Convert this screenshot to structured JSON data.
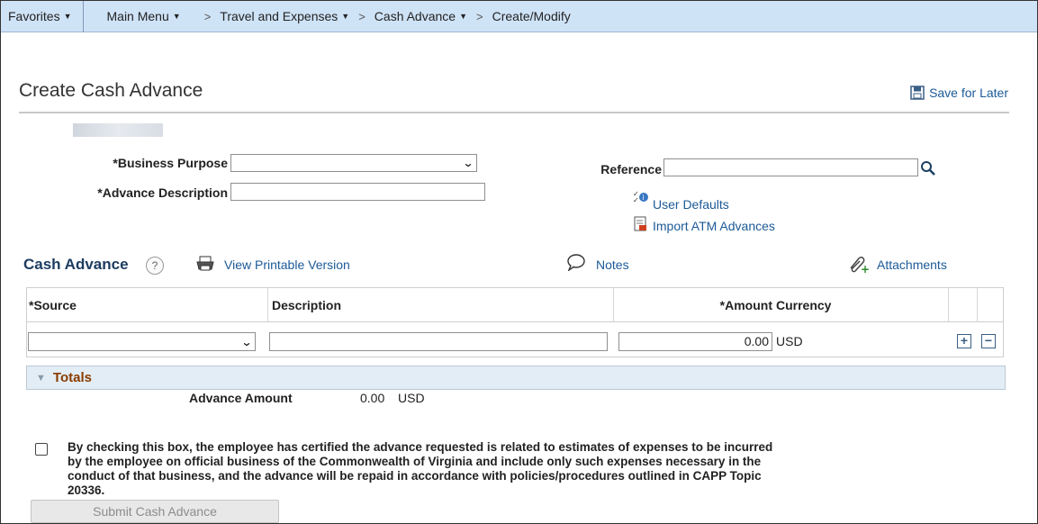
{
  "nav": {
    "favorites": "Favorites",
    "main_menu": "Main Menu",
    "breadcrumbs": [
      "Travel and Expenses",
      "Cash Advance",
      "Create/Modify"
    ]
  },
  "page": {
    "title": "Create Cash Advance",
    "save_for_later": "Save for Later"
  },
  "form": {
    "business_purpose_label": "*Business Purpose",
    "business_purpose_value": "",
    "advance_description_label": "*Advance Description",
    "advance_description_value": "",
    "reference_label": "Reference",
    "reference_value": "",
    "user_defaults": "User Defaults",
    "import_atm": "Import ATM Advances"
  },
  "cash_advance": {
    "title": "Cash Advance",
    "help": "?",
    "view_printable": "View Printable Version",
    "notes": "Notes",
    "attachments": "Attachments",
    "columns": [
      "*Source",
      "Description",
      "*Amount",
      "Currency"
    ],
    "row": {
      "source": "",
      "description": "",
      "amount": "0.00",
      "currency": "USD"
    }
  },
  "totals": {
    "title": "Totals",
    "advance_amount_label": "Advance Amount",
    "advance_amount_value": "0.00",
    "advance_amount_currency": "USD"
  },
  "certification": {
    "checked": false,
    "text": "By checking this box, the employee has certified the advance requested is related to estimates of expenses to be incurred by the employee on official business of the Commonwealth of Virginia and include only such expenses necessary in the conduct of that business, and the advance will be repaid in accordance with policies/procedures outlined in CAPP Topic 20336."
  },
  "submit_label": "Submit Cash Advance",
  "colors": {
    "nav_bg": "#cfe3f7",
    "link": "#1c5a97",
    "section_title": "#1d3c60",
    "totals_title": "#8a3c00"
  }
}
